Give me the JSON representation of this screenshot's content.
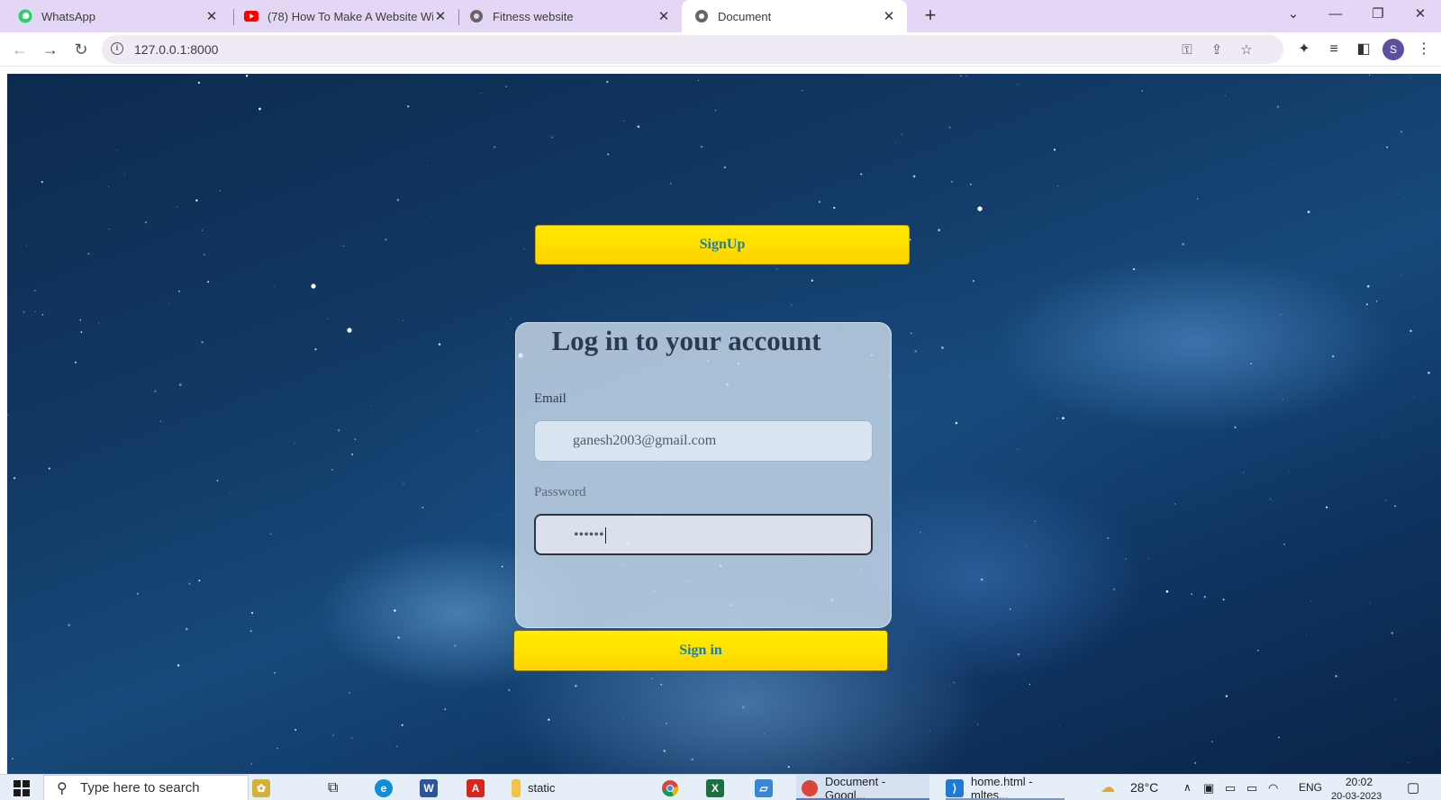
{
  "browser": {
    "tabs": [
      {
        "title": "WhatsApp",
        "icon": "whatsapp-icon",
        "color": "#25d366"
      },
      {
        "title": "(78) How To Make A Website Wit",
        "icon": "youtube-icon",
        "color": "#ff0000"
      },
      {
        "title": "Fitness website",
        "icon": "globe-icon",
        "color": "#555555"
      },
      {
        "title": "Document",
        "icon": "globe-icon",
        "color": "#555555",
        "active": true
      }
    ],
    "url": "127.0.0.1:8000",
    "profile_initial": "S"
  },
  "page": {
    "signup_label": "SignUp",
    "login_title": "Log in to your account",
    "email_label": "Email",
    "email_value": "ganesh2003@gmail.com",
    "password_label": "Password",
    "password_value": "••••••",
    "signin_label": "Sign in",
    "button_color": "#ffe000",
    "button_text_color": "#1e7fa8"
  },
  "taskbar": {
    "search_placeholder": "Type here to search",
    "items": [
      {
        "label": "static",
        "icon": "folder-icon"
      },
      {
        "label": "Document - Googl...",
        "icon": "chrome-icon"
      },
      {
        "label": "home.html - mltes...",
        "icon": "vscode-icon"
      }
    ],
    "weather": "28°C",
    "language": "ENG",
    "time": "20:02",
    "date": "20-03-2023"
  }
}
